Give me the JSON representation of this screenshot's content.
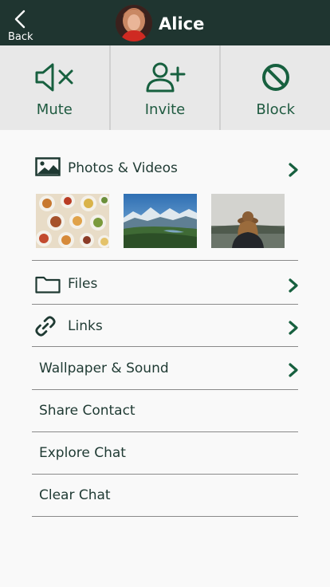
{
  "header": {
    "back_label": "Back",
    "contact_name": "Alice"
  },
  "actions": [
    {
      "label": "Mute",
      "icon": "mute-icon"
    },
    {
      "label": "Invite",
      "icon": "add-user-icon"
    },
    {
      "label": "Block",
      "icon": "block-icon"
    }
  ],
  "media": {
    "label": "Photos & Videos",
    "icon": "image-icon",
    "thumbnails": [
      "food-platter-photo",
      "mountain-landscape-photo",
      "woman-hat-photo"
    ]
  },
  "items": [
    {
      "label": "Files",
      "icon": "folder-icon",
      "chevron": true
    },
    {
      "label": "Links",
      "icon": "link-icon",
      "chevron": true
    },
    {
      "label": "Wallpaper & Sound",
      "chevron": true
    },
    {
      "label": "Share Contact",
      "chevron": false
    },
    {
      "label": "Explore Chat",
      "chevron": false
    },
    {
      "label": "Clear Chat",
      "chevron": false
    }
  ],
  "colors": {
    "header_bg": "#1f3530",
    "accent": "#17603f",
    "action_bg": "#e8e8e8"
  }
}
